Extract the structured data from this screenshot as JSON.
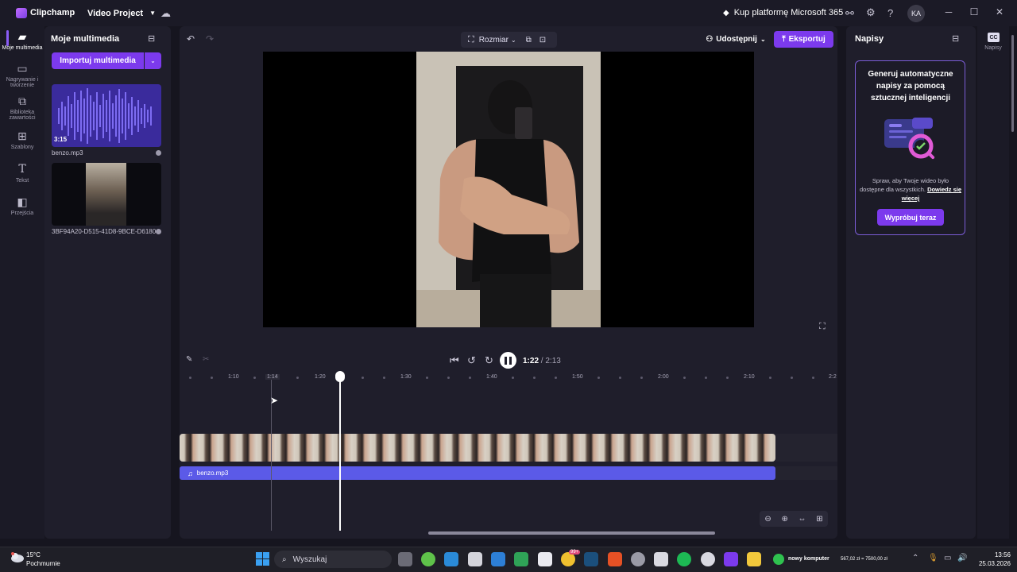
{
  "titlebar": {
    "app_name": "Clipchamp",
    "project_name": "Video Project",
    "buy_label": "Kup platformę Microsoft 365",
    "avatar_initials": "KA"
  },
  "leftnav": {
    "items": [
      {
        "label": "Moje multimedia",
        "icon": "folder-icon"
      },
      {
        "label": "Nagrywanie i tworzenie",
        "icon": "camera-icon"
      },
      {
        "label": "Biblioteka zawartości",
        "icon": "library-icon"
      },
      {
        "label": "Szablony",
        "icon": "templates-icon"
      },
      {
        "label": "Tekst",
        "icon": "text-icon"
      },
      {
        "label": "Przejścia",
        "icon": "transitions-icon"
      }
    ]
  },
  "media": {
    "title": "Moje multimedia",
    "import_label": "Importuj multimedia",
    "items": [
      {
        "name": "benzo.mp3",
        "duration": "3:15"
      },
      {
        "name": "3BF94A20-D515-41D8-9BCE-D6180..."
      }
    ]
  },
  "editor": {
    "resize_label": "Rozmiar",
    "share_label": "Udostępnij",
    "export_label": "Eksportuj",
    "current_time": "1:22",
    "total_time": "/ 2:13",
    "ruler": [
      "1:10",
      "1:14",
      "1:20",
      "1:30",
      "1:40",
      "1:50",
      "2:00",
      "2:10",
      "2:2"
    ],
    "audio_clip": "benzo.mp3"
  },
  "captions": {
    "title": "Napisy",
    "heading": "Generuj automatyczne napisy za pomocą sztucznej inteligencji",
    "desc": "Spraw, aby Twoje wideo było dostępne dla wszystkich.",
    "learn_more": "Dowiedz się więcej",
    "try_label": "Wypróbuj teraz",
    "side_label": "Napisy",
    "cc": "CC"
  },
  "taskbar": {
    "temp": "15°C",
    "weather": "Pochmurnie",
    "search_placeholder": "Wyszukaj",
    "tray_app": "nowy komputer",
    "tray_price": "567,02 zł = 7500,00 zł",
    "time": "13:56",
    "date": "25.03.2026",
    "notification_count": "99+"
  },
  "colors": {
    "accent": "#7c3aed",
    "audio_track": "#5b5ae8"
  }
}
